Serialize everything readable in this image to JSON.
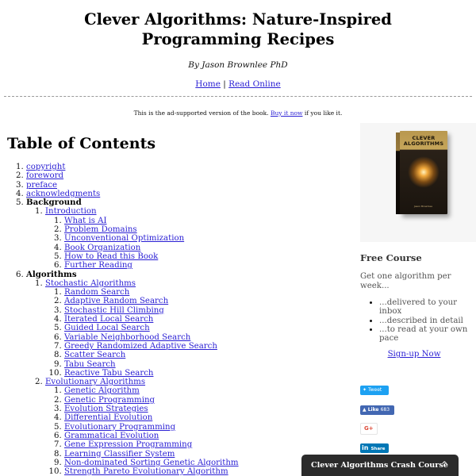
{
  "header": {
    "title": "Clever Algorithms: Nature-Inspired Programming Recipes",
    "byline": "By Jason Brownlee PhD",
    "nav": {
      "home": "Home",
      "separator": " | ",
      "read_online": "Read Online"
    }
  },
  "ad_note": {
    "prefix": "This is the ad-supported version of the book. ",
    "link": "Buy it now",
    "suffix": " if you like it."
  },
  "toc": {
    "title": "Table of Contents",
    "front": [
      "copyright",
      "foreword",
      "preface",
      "acknowledgments"
    ],
    "background": {
      "label": "Background",
      "chapter": "Introduction",
      "items": [
        "What is AI",
        "Problem Domains",
        "Unconventional Optimization",
        "Book Organization",
        "How to Read this Book",
        "Further Reading"
      ]
    },
    "algorithms": {
      "label": "Algorithms",
      "stochastic": {
        "label": "Stochastic Algorithms",
        "items": [
          "Random Search",
          "Adaptive Random Search",
          "Stochastic Hill Climbing",
          "Iterated Local Search",
          "Guided Local Search",
          "Variable Neighborhood Search",
          "Greedy Randomized Adaptive Search",
          "Scatter Search",
          "Tabu Search",
          "Reactive Tabu Search"
        ]
      },
      "evolutionary": {
        "label": "Evolutionary Algorithms",
        "items": [
          "Genetic Algorithm",
          "Genetic Programming",
          "Evolution Strategies",
          "Differential Evolution",
          "Evolutionary Programming",
          "Grammatical Evolution",
          "Gene Expression Programming",
          "Learning Classifier System",
          "Non-dominated Sorting Genetic Algorithm",
          "Strength Pareto Evolutionary Algorithm"
        ]
      }
    }
  },
  "sidebar": {
    "book": {
      "title_line1": "CLEVER",
      "title_line2": "ALGORITHMS",
      "author": "Jason Brownlee"
    },
    "course": {
      "title": "Free Course",
      "desc": "Get one algorithm per week...",
      "bullets": [
        "...delivered to your inbox",
        "...described in detail",
        "...to read at your own pace"
      ],
      "signup": "Sign-up Now"
    },
    "share": {
      "tweet": "Tweet",
      "like": "Like",
      "like_count": "683",
      "gplus": "G+",
      "linkedin_logo": "in",
      "linkedin": "Share"
    }
  },
  "crash_course": {
    "label": "Clever Algorithms Crash Course",
    "chevron": "^"
  }
}
